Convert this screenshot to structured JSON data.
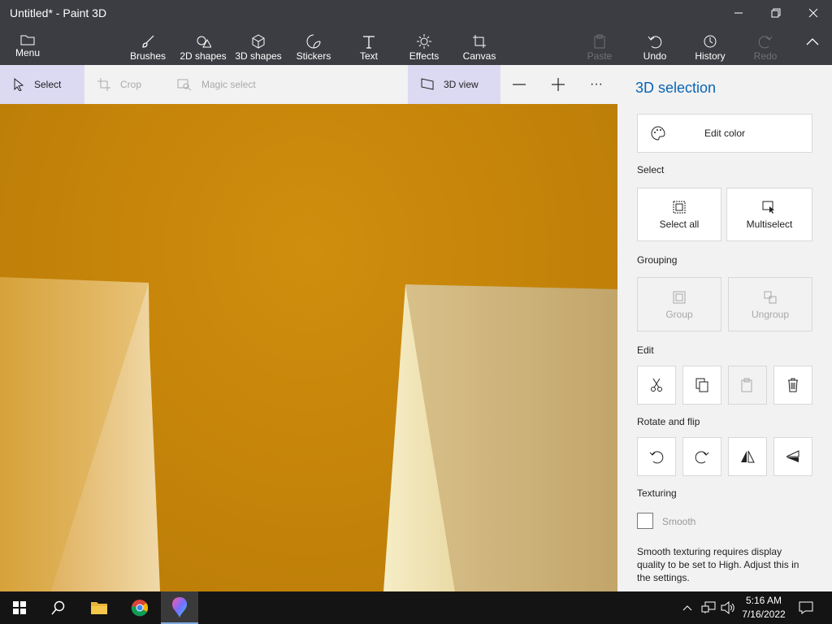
{
  "window": {
    "title": "Untitled* - Paint 3D"
  },
  "ribbon": {
    "menu": "Menu",
    "brushes": "Brushes",
    "shapes2d": "2D shapes",
    "shapes3d": "3D shapes",
    "stickers": "Stickers",
    "text": "Text",
    "effects": "Effects",
    "canvas": "Canvas",
    "paste": "Paste",
    "undo": "Undo",
    "history": "History",
    "redo": "Redo"
  },
  "toolbar": {
    "select": "Select",
    "crop": "Crop",
    "magic_select": "Magic select",
    "view3d": "3D view",
    "more": "···"
  },
  "panel": {
    "title": "3D selection",
    "edit_color": "Edit color",
    "select_heading": "Select",
    "select_all": "Select all",
    "multiselect": "Multiselect",
    "grouping_heading": "Grouping",
    "group": "Group",
    "ungroup": "Ungroup",
    "edit_heading": "Edit",
    "rotate_heading": "Rotate and flip",
    "texturing_heading": "Texturing",
    "smooth": "Smooth",
    "smooth_note": "Smooth texturing requires display quality to be set to High. Adjust this in the settings."
  },
  "taskbar": {
    "time": "5:16 AM",
    "date": "7/16/2022"
  },
  "colors": {
    "chrome": "#3b3d42",
    "accent": "#0a64b4",
    "canvas": "#c7860a"
  }
}
